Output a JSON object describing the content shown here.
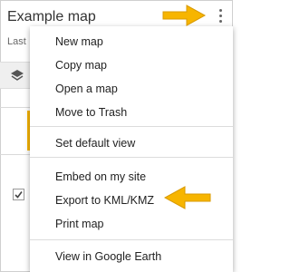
{
  "panel": {
    "title": "Example map",
    "subtitle": "Last"
  },
  "menu": {
    "items": [
      {
        "label": "New map"
      },
      {
        "label": "Copy map"
      },
      {
        "label": "Open a map"
      },
      {
        "label": "Move to Trash"
      },
      {
        "label": "Set default view"
      },
      {
        "label": "Embed on my site"
      },
      {
        "label": "Export to KML/KMZ"
      },
      {
        "label": "Print map"
      },
      {
        "label": "View in Google Earth"
      }
    ]
  },
  "colors": {
    "callout_arrow": "#f7b500",
    "menu_text": "#222222",
    "muted_text": "#666666",
    "separator": "#dcdcdc"
  },
  "icons": {
    "more": "three-dots-vertical-icon",
    "layers": "layers-icon",
    "checkbox": "checkbox-checked-icon",
    "callout": "arrow-icon"
  }
}
